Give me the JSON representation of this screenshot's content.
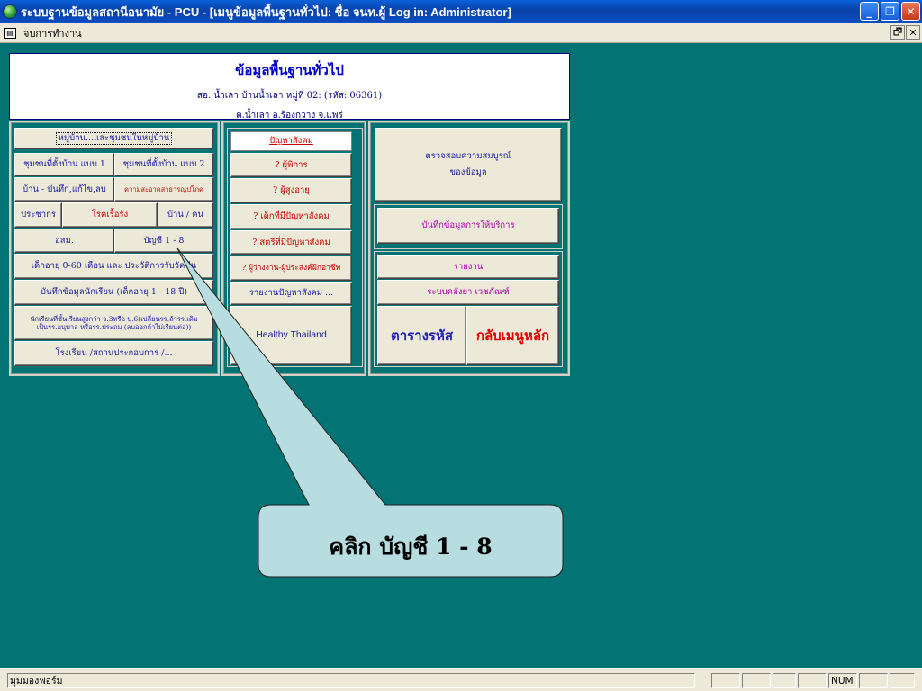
{
  "window": {
    "title": "ระบบฐานข้อมูลสถานีอนามัย - PCU - [เมนูข้อมูลพื้นฐานทั่วไป: ชื่อ จนท.ผู้ Log in: Administrator]",
    "minimize": "_",
    "restore": "❐",
    "close": "✕"
  },
  "menubar": {
    "item": "จบการทำงาน",
    "restore": "🗗",
    "close": "✕"
  },
  "header": {
    "title": "ข้อมูลพื้นฐานทั่วไป",
    "line1": "สอ. น้ำเลา บ้านน้ำเลา หมู่ที่ 02: (รหัส: 06361)",
    "line2": "ต.น้ำเลา อ.ร้องกวาง จ.แพร่"
  },
  "left_panel": {
    "village": "หมู่บ้าน...และชุมชนในหมู่บ้าน",
    "community1": "ชุมชนที่ตั้งบ้าน แบบ 1",
    "community2": "ชุมชนที่ตั้งบ้าน แบบ 2",
    "house": "บ้าน - บันทึก,แก้ไข,ลบ",
    "sanitation": "ความสะอาดสาธารณูปโภค",
    "population": "ประชากร",
    "chronic": "โรคเรื้อรัง",
    "house_per_person": "บ้าน / คน",
    "osm": "อสม.",
    "account": "บัญชี 1 - 8",
    "child_vaccine": "เด็กอายุ 0-60 เดือน และ ประวัติการรับวัคซีน",
    "student": "บันทึกข้อมูลนักเรียน (เด็กอายุ 1 - 18 ปี)",
    "student_grad_1": "นักเรียนที่ชั้นเรียนสูงกว่า จ.3หรือ ป.6(เปลี่ยนรร.ถ้ารร.เดิม",
    "student_grad_2": "เป็นรร.อนุบาล หรือรร.ประถม (ลบออกถ้าไม่เรียนต่อ))",
    "school": "โรงเรียน /สถานประกอบการ /..."
  },
  "middle_panel": {
    "social": "ปัญหาสังคม",
    "disabled": "? ผู้พิการ",
    "elderly": "? ผู้สูงอายุ",
    "child_problem": "? เด็กที่มีปัญหาสังคม",
    "women_problem": "? สตรีที่มีปัญหาสังคม",
    "unemployed": "? ผู้ว่างงาน-ผู้ประสงค์ฝึกอาชีพ",
    "report": "รายงานปัญหาสังคม ...",
    "healthy": "Healthy Thailand"
  },
  "right_panel": {
    "check_1": "ตรวจสอบความสมบูรณ์",
    "check_2": "ของข้อมูล",
    "service": "บันทึกข้อมูลการให้บริการ",
    "report": "รายงาน",
    "drug_stock": "ระบบคลังยา-เวชภัณฑ์",
    "code_table": "ตารางรหัส",
    "main_menu": "กลับเมนูหลัก"
  },
  "callout": {
    "text": "คลิก บัญชี 1 - 8"
  },
  "statusbar": {
    "text": "มุมมองฟอร์ม",
    "num": "NUM"
  },
  "colors": {
    "workspace": "#037373",
    "callout_fill": "#b7dde0",
    "title_bar": "#0a4ec4"
  }
}
